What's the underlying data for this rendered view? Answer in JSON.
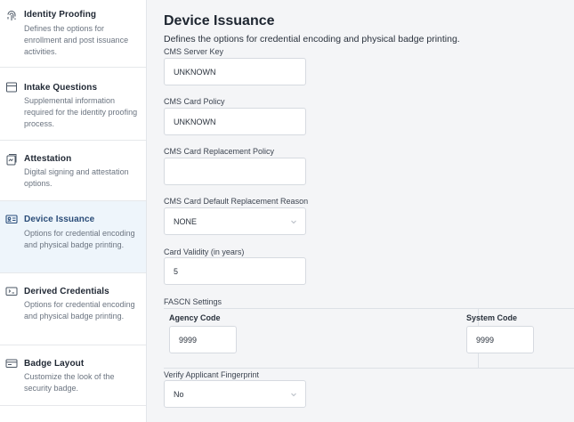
{
  "sidebar": {
    "items": [
      {
        "icon": "fingerprint-icon",
        "title": "Identity Proofing",
        "desc": "Defines the options for enrollment and post issuance activities.",
        "active": false
      },
      {
        "icon": "inbox-icon",
        "title": "Intake Questions",
        "desc": "Supplemental information required for the identity proofing process.",
        "active": false
      },
      {
        "icon": "signature-icon",
        "title": "Attestation",
        "desc": "Digital signing and attestation options.",
        "active": false
      },
      {
        "icon": "id-card-icon",
        "title": "Device Issuance",
        "desc": "Options for credential encoding and physical badge printing.",
        "active": true
      },
      {
        "icon": "derived-credential-icon",
        "title": "Derived Credentials",
        "desc": "Options for credential encoding and physical badge printing.",
        "active": false
      },
      {
        "icon": "badge-layout-icon",
        "title": "Badge Layout",
        "desc": "Customize the look of the security badge.",
        "active": false
      }
    ]
  },
  "main": {
    "title": "Device Issuance",
    "subtitle": "Defines the options for credential encoding and physical badge printing.",
    "fields": {
      "cms_server_key": {
        "label": "CMS Server Key",
        "value": "UNKNOWN"
      },
      "cms_card_policy": {
        "label": "CMS Card Policy",
        "value": "UNKNOWN"
      },
      "cms_card_replacement_policy": {
        "label": "CMS Card Replacement Policy",
        "value": ""
      },
      "cms_card_default_replacement_reason": {
        "label": "CMS Card Default Replacement Reason",
        "value": "NONE"
      },
      "card_validity": {
        "label": "Card Validity (in years)",
        "value": "5"
      },
      "verify_applicant_fingerprint": {
        "label": "Verify Applicant Fingerprint",
        "value": "No"
      }
    },
    "fascn": {
      "label": "FASCN Settings",
      "agency_code": {
        "label": "Agency Code",
        "value": "9999"
      },
      "system_code": {
        "label": "System Code",
        "value": "9999"
      }
    }
  },
  "colors": {
    "active_bg": "#eef5fb",
    "active_text": "#2a4c78",
    "page_bg": "#f4f5f7"
  }
}
